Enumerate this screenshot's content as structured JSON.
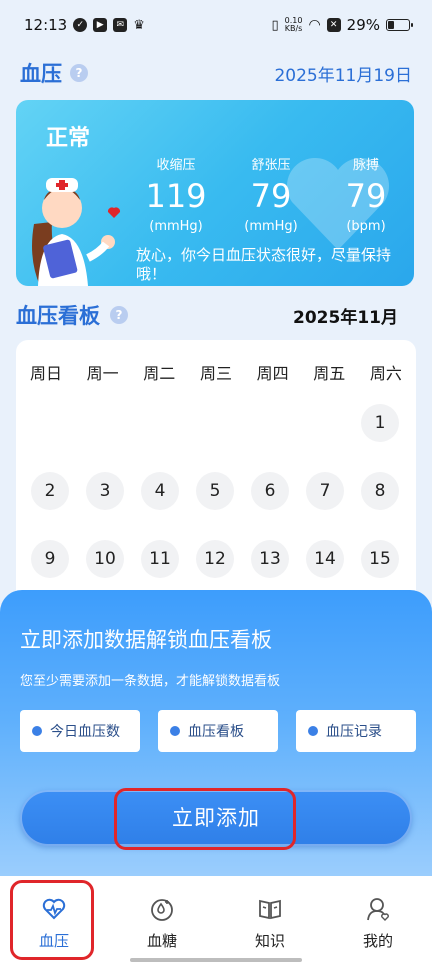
{
  "status_bar": {
    "time": "12:13",
    "net_speed_value": "0.10",
    "net_speed_unit": "KB/s",
    "battery": "29%"
  },
  "header": {
    "title": "血压",
    "help": "?",
    "date": "2025年11月19日"
  },
  "card": {
    "status": "正常",
    "metrics": [
      {
        "label": "收缩压",
        "value": "119",
        "unit": "(mmHg)"
      },
      {
        "label": "舒张压",
        "value": "79",
        "unit": "(mmHg)"
      },
      {
        "label": "脉搏",
        "value": "79",
        "unit": "(bpm)"
      }
    ],
    "message": "放心，你今日血压状态很好，尽量保持哦！"
  },
  "board": {
    "title": "血压看板",
    "help": "?",
    "month": "2025年11月"
  },
  "calendar": {
    "weekdays": [
      "周日",
      "周一",
      "周二",
      "周三",
      "周四",
      "周五",
      "周六"
    ],
    "days": [
      "1",
      "2",
      "3",
      "4",
      "5",
      "6",
      "7",
      "8",
      "9",
      "10",
      "11",
      "12",
      "13",
      "14",
      "15"
    ]
  },
  "unlock": {
    "title": "立即添加数据解锁血压看板",
    "subtitle": "您至少需要添加一条数据，才能解锁数据看板",
    "chips": [
      "今日血压数",
      "血压看板",
      "血压记录"
    ],
    "button": "立即添加"
  },
  "nav": {
    "items": [
      {
        "label": "血压",
        "icon": "heart-pulse-icon"
      },
      {
        "label": "血糖",
        "icon": "blood-drop-icon"
      },
      {
        "label": "知识",
        "icon": "book-icon"
      },
      {
        "label": "我的",
        "icon": "user-icon"
      }
    ]
  },
  "colors": {
    "accent": "#2b6fd6",
    "card": "#39bbf0",
    "highlight": "#e0262a"
  }
}
